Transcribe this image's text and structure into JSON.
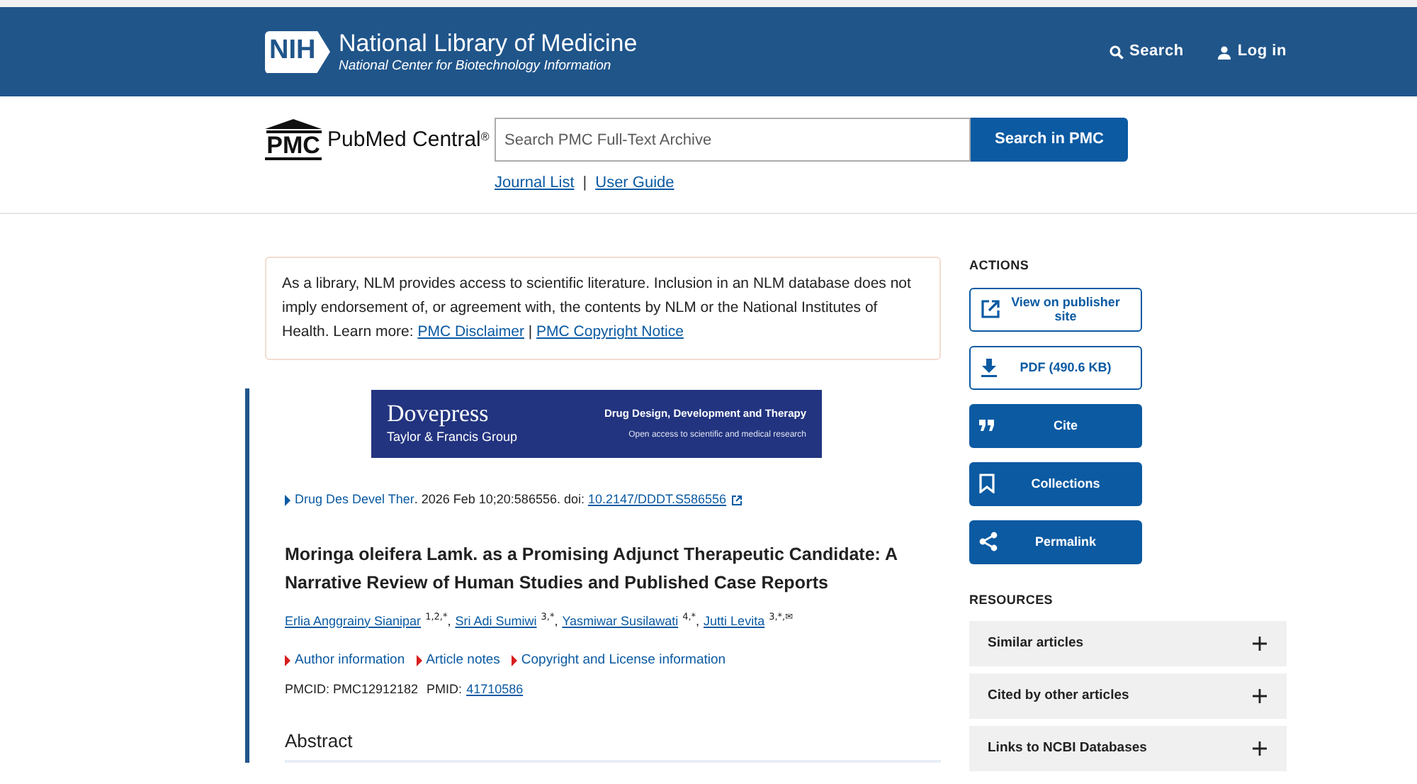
{
  "header": {
    "logo": "NIH",
    "title": "National Library of Medicine",
    "subtitle": "National Center for Biotechnology Information",
    "links": [
      {
        "kind": "search",
        "label": "Search"
      },
      {
        "kind": "login",
        "label": "Log in"
      }
    ]
  },
  "pmc": {
    "logo": "PMC",
    "name": "PubMed Central",
    "mark": "®",
    "search_placeholder": "Search PMC Full-Text Archive",
    "search_button": "Search in PMC",
    "links": [
      "Journal List",
      "User Guide"
    ],
    "separator": "|"
  },
  "notice": {
    "text": "As a library, NLM provides access to scientific literature. Inclusion in an NLM database does not imply endorsement of, or agreement with, the contents by NLM or the National Institutes of Health.",
    "learn_more": "Learn more:",
    "links": [
      "PMC Disclaimer",
      "PMC Copyright Notice"
    ],
    "separator": "|"
  },
  "banner": {
    "brand": "Dovepress",
    "group": "Taylor & Francis Group",
    "journal": "Drug Design, Development and Therapy",
    "tagline": "Open access to scientific and medical research"
  },
  "citation": {
    "journal": "Drug Des Devel Ther",
    "details": ". 2026 Feb 10;20:586556. doi: ",
    "doi": "10.2147/DDDT.S586556"
  },
  "article": {
    "title": "Moringa oleifera Lamk. as a Promising Adjunct Therapeutic Candidate: A Narrative Review of Human Studies and Published Case Reports",
    "author_separator": ",",
    "authors": [
      {
        "name": "Erlia Anggrainy Sianipar",
        "sup": "1,2,*"
      },
      {
        "name": "Sri Adi Sumiwi",
        "sup": "3,*"
      },
      {
        "name": "Yasmiwar Susilawati",
        "sup": "4,*"
      },
      {
        "name": "Jutti Levita",
        "sup": "3,*,✉"
      }
    ],
    "info_links": [
      "Author information",
      "Article notes",
      "Copyright and License information"
    ],
    "pmcid": "PMCID: PMC12912182",
    "pmid_label": "PMID:",
    "pmid": "41710586",
    "section": "Abstract"
  },
  "actions": {
    "heading": "ACTIONS",
    "buttons": [
      {
        "kind": "publisher",
        "label": "View on publisher site"
      },
      {
        "kind": "pdf",
        "label": "PDF (490.6 KB)"
      },
      {
        "kind": "cite",
        "label": "Cite"
      },
      {
        "kind": "collections",
        "label": "Collections"
      },
      {
        "kind": "permalink",
        "label": "Permalink"
      }
    ]
  },
  "resources": {
    "heading": "RESOURCES",
    "items": [
      {
        "label": "Similar articles",
        "expanded": false
      },
      {
        "label": "Cited by other articles",
        "expanded": false
      },
      {
        "label": "Links to NCBI Databases",
        "expanded": false
      }
    ]
  }
}
